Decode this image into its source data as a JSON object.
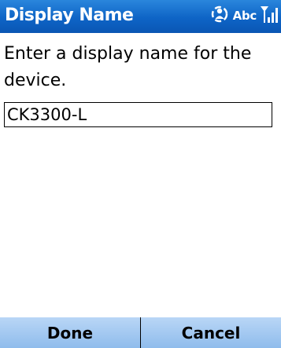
{
  "title_bar": {
    "title": "Display Name",
    "status_icons": [
      "sync-person-icon",
      "abc-input-mode-indicator",
      "signal-strength-icon"
    ],
    "input_mode": "Abc",
    "background": "#0e64c6"
  },
  "content": {
    "prompt": "Enter a display name for the device.",
    "display_name_value": "CK3300-L"
  },
  "softkeys": {
    "left": "Done",
    "right": "Cancel",
    "background": "#a5c9f1"
  }
}
